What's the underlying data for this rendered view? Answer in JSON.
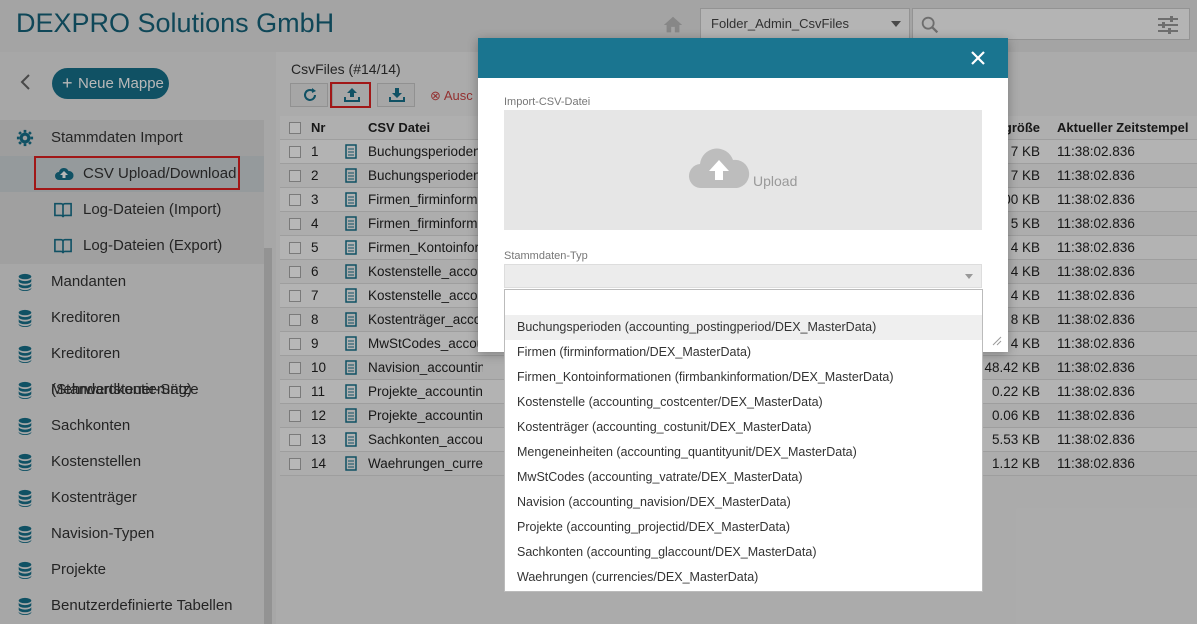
{
  "header": {
    "brand": "DEXPRO Solutions GmbH",
    "folder_value": "Folder_Admin_CsvFiles"
  },
  "sidebar": {
    "new_button": "Neue Mappe",
    "section": "Stammdaten Import",
    "sub_items": [
      "CSV Upload/Download",
      "Log-Dateien (Import)",
      "Log-Dateien (Export)"
    ],
    "items": [
      "Mandanten",
      "Kreditoren",
      "Kreditoren (Standardkontierung)",
      "Mehrwertsteuer-Sätze",
      "Sachkonten",
      "Kostenstellen",
      "Kostenträger",
      "Navision-Typen",
      "Projekte",
      "Benutzerdefinierte Tabellen"
    ]
  },
  "main": {
    "title": "CsvFiles (#14/14)",
    "disabled_button": "Ausc",
    "columns": {
      "nr": "Nr",
      "file": "CSV Datei",
      "size": "igröße",
      "timestamp": "Aktueller Zeitstempel"
    },
    "rows": [
      {
        "nr": "1",
        "file": "Buchungsperioden",
        "size": "7 KB",
        "ts": "11:38:02.836"
      },
      {
        "nr": "2",
        "file": "Buchungsperioden",
        "size": "7 KB",
        "ts": "11:38:02.836"
      },
      {
        "nr": "3",
        "file": "Firmen_firminform",
        "size": "00 KB",
        "ts": "11:38:02.836"
      },
      {
        "nr": "4",
        "file": "Firmen_firminform",
        "size": "5 KB",
        "ts": "11:38:02.836"
      },
      {
        "nr": "5",
        "file": "Firmen_Kontoinfor",
        "size": "4 KB",
        "ts": "11:38:02.836"
      },
      {
        "nr": "6",
        "file": "Kostenstelle_accou",
        "size": "4 KB",
        "ts": "11:38:02.836"
      },
      {
        "nr": "7",
        "file": "Kostenstelle_accou",
        "size": "4 KB",
        "ts": "11:38:02.836"
      },
      {
        "nr": "8",
        "file": "Kostenträger_acco",
        "size": "8 KB",
        "ts": "11:38:02.836"
      },
      {
        "nr": "9",
        "file": "MwStCodes_accou",
        "size": "4 KB",
        "ts": "11:38:02.836"
      },
      {
        "nr": "10",
        "file": "Navision_accounting_n",
        "size": "48.42 KB",
        "ts": "11:38:02.836"
      },
      {
        "nr": "11",
        "file": "Projekte_accounting_pr",
        "size": "0.22 KB",
        "ts": "11:38:02.836"
      },
      {
        "nr": "12",
        "file": "Projekte_accounting_pr",
        "size": "0.06 KB",
        "ts": "11:38:02.836"
      },
      {
        "nr": "13",
        "file": "Sachkonten_accounting",
        "size": "5.53 KB",
        "ts": "11:38:02.836"
      },
      {
        "nr": "14",
        "file": "Waehrungen_currencies",
        "size": "1.12 KB",
        "ts": "11:38:02.836"
      }
    ]
  },
  "modal": {
    "import_label": "Import-CSV-Datei",
    "upload_label": "Upload",
    "type_label": "Stammdaten-Typ"
  },
  "dropdown": {
    "options": [
      "Buchungsperioden (accounting_postingperiod/DEX_MasterData)",
      "Firmen (firminformation/DEX_MasterData)",
      "Firmen_Kontoinformationen (firmbankinformation/DEX_MasterData)",
      "Kostenstelle (accounting_costcenter/DEX_MasterData)",
      "Kostenträger (accounting_costunit/DEX_MasterData)",
      "Mengeneinheiten (accounting_quantityunit/DEX_MasterData)",
      "MwStCodes (accounting_vatrate/DEX_MasterData)",
      "Navision (accounting_navision/DEX_MasterData)",
      "Projekte (accounting_projectid/DEX_MasterData)",
      "Sachkonten (accounting_glaccount/DEX_MasterData)",
      "Waehrungen (currencies/DEX_MasterData)"
    ]
  },
  "colors": {
    "accent": "#17718b",
    "highlight_box": "#e02020"
  }
}
